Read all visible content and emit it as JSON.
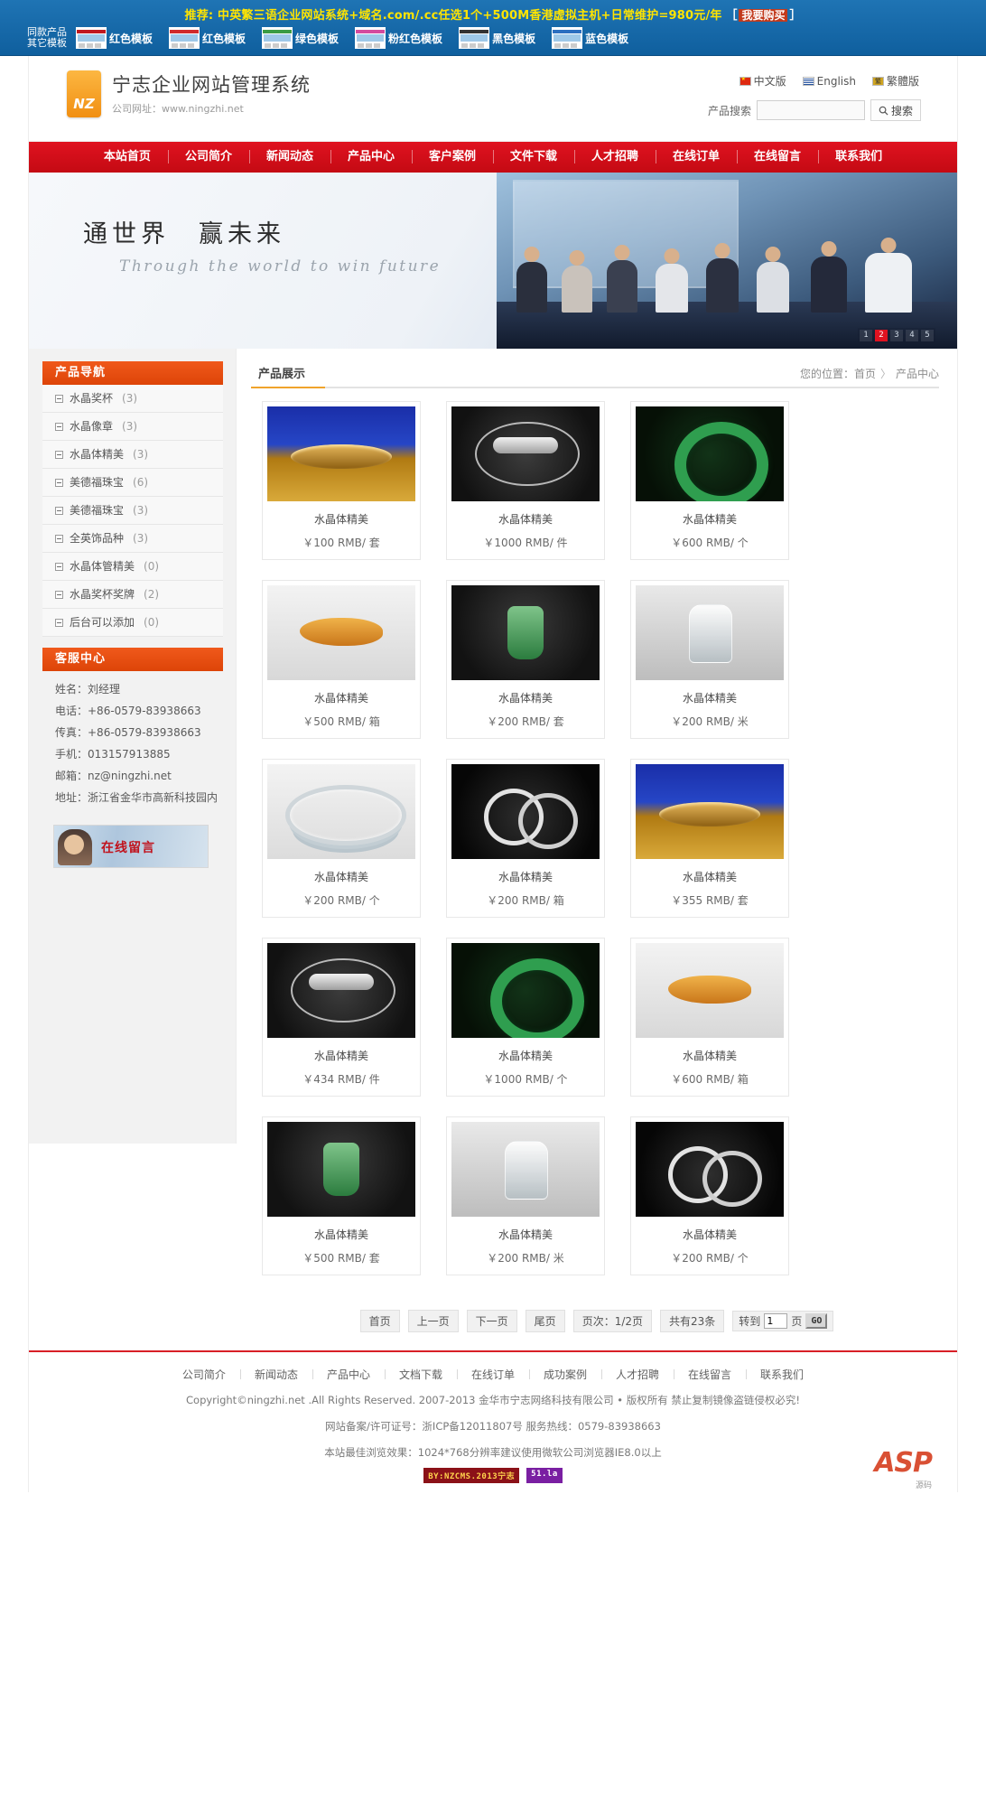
{
  "promo": {
    "recommend_text": "推荐: 中英繁三语企业网站系统+域名.com/.cc任选1个+500M香港虚拟主机+日常维护=980元/年",
    "bracket_open": "［",
    "bracket_close": "］",
    "buy_label": "我要购买",
    "same_product_label_line1": "同款产品",
    "same_product_label_line2": "其它模板",
    "templates": [
      {
        "label": "红色模板",
        "color": "#c01820"
      },
      {
        "label": "红色模板",
        "color": "#d02b2b"
      },
      {
        "label": "绿色模板",
        "color": "#3a9c44"
      },
      {
        "label": "粉红色模板",
        "color": "#d44b9e"
      },
      {
        "label": "黑色模板",
        "color": "#333333"
      },
      {
        "label": "蓝色模板",
        "color": "#2b6fc0"
      }
    ]
  },
  "header": {
    "logo_text": "NZ",
    "site_title": "宁志企业网站管理系统",
    "site_url": "公司网址：www.ningzhi.net",
    "languages": [
      {
        "label": "中文版",
        "flag": "cn"
      },
      {
        "label": "English",
        "flag": "en"
      },
      {
        "label": "繁體版",
        "flag": "tw"
      }
    ],
    "search": {
      "label": "产品搜索",
      "value": "",
      "placeholder": "",
      "button_label": "搜索",
      "button_icon": "search-icon"
    }
  },
  "mainnav": {
    "items": [
      "本站首页",
      "公司简介",
      "新闻动态",
      "产品中心",
      "客户案例",
      "文件下载",
      "人才招聘",
      "在线订单",
      "在线留言",
      "联系我们"
    ]
  },
  "banner": {
    "cn_slogan": "通世界　赢未来",
    "en_slogan": "Through the world to win future",
    "dots": [
      "1",
      "2",
      "3",
      "4",
      "5"
    ],
    "active_dot": "2"
  },
  "sidebar": {
    "products_nav_title": "产品导航",
    "categories": [
      {
        "name": "水晶奖杯",
        "count": "(3)"
      },
      {
        "name": "水晶像章",
        "count": "(3)"
      },
      {
        "name": "水晶体精美",
        "count": "(3)"
      },
      {
        "name": "美德福珠宝",
        "count": "(6)"
      },
      {
        "name": "美德福珠宝",
        "count": "(3)"
      },
      {
        "name": "全英饰品种",
        "count": "(3)"
      },
      {
        "name": "水晶体管精美",
        "count": "(0)"
      },
      {
        "name": "水晶奖杯奖牌",
        "count": "(2)"
      },
      {
        "name": "后台可以添加",
        "count": "(0)"
      }
    ],
    "service_title": "客服中心",
    "contacts": [
      "姓名：刘经理",
      "电话：+86-0579-83938663",
      "传真：+86-0579-83938663",
      "手机：013157913885",
      "邮箱：nz@ningzhi.net",
      "地址：浙江省金华市高新科技园内"
    ],
    "message_banner_label": "在线留言"
  },
  "content": {
    "tab_label": "产品展示",
    "breadcrumb_prefix": "您的位置：",
    "breadcrumb_home": "首页",
    "breadcrumb_sep": "〉",
    "breadcrumb_current": "产品中心",
    "products": [
      {
        "name": "水晶体精美",
        "price": "￥100 RMB/ 套",
        "photo": "ph-gold"
      },
      {
        "name": "水晶体精美",
        "price": "￥1000 RMB/ 件",
        "photo": "ph-keys"
      },
      {
        "name": "水晶体精美",
        "price": "￥600 RMB/ 个",
        "photo": "ph-jadering"
      },
      {
        "name": "水晶体精美",
        "price": "￥500 RMB/ 箱",
        "photo": "ph-amber"
      },
      {
        "name": "水晶体精美",
        "price": "￥200 RMB/ 套",
        "photo": "ph-jadependant"
      },
      {
        "name": "水晶体精美",
        "price": "￥200 RMB/ 米",
        "photo": "ph-buddha"
      },
      {
        "name": "水晶体精美",
        "price": "￥200 RMB/ 个",
        "photo": "ph-bangles"
      },
      {
        "name": "水晶体精美",
        "price": "￥200 RMB/ 箱",
        "photo": "ph-tworings"
      },
      {
        "name": "水晶体精美",
        "price": "￥355 RMB/ 套",
        "photo": "ph-gold"
      },
      {
        "name": "水晶体精美",
        "price": "￥434 RMB/ 件",
        "photo": "ph-keys"
      },
      {
        "name": "水晶体精美",
        "price": "￥1000 RMB/ 个",
        "photo": "ph-jadering"
      },
      {
        "name": "水晶体精美",
        "price": "￥600 RMB/ 箱",
        "photo": "ph-amber"
      },
      {
        "name": "水晶体精美",
        "price": "￥500 RMB/ 套",
        "photo": "ph-jadependant"
      },
      {
        "name": "水晶体精美",
        "price": "￥200 RMB/ 米",
        "photo": "ph-buddha"
      },
      {
        "name": "水晶体精美",
        "price": "￥200 RMB/ 个",
        "photo": "ph-tworings"
      }
    ]
  },
  "pager": {
    "first": "首页",
    "prev": "上一页",
    "next": "下一页",
    "last": "尾页",
    "page_info": "页次：1/2页",
    "total_info": "共有23条",
    "goto_prefix": "转到",
    "goto_value": "1",
    "goto_suffix": "页",
    "go_label": "GO"
  },
  "footer": {
    "links": [
      "公司简介",
      "新闻动态",
      "产品中心",
      "文档下载",
      "在线订单",
      "成功案例",
      "人才招聘",
      "在线留言",
      "联系我们"
    ],
    "copyright": "Copyright©ningzhi.net .All Rights Reserved. 2007-2013 金华市宁志网络科技有限公司 • 版权所有  禁止复制镜像盗链侵权必究!",
    "icp": "网站备案/许可证号：浙ICP备12011807号  服务热线：0579-83938663",
    "browser_tip": "本站最佳浏览效果：1024*768分辨率建议使用微软公司浏览器IE8.0以上",
    "badge_nz": "BY:NZCMS.2013宁志",
    "badge_51": "51.la",
    "asp_logo": "ASP",
    "asp_sub": "源码"
  },
  "colors": {
    "promo_blue": "#1468a8",
    "nav_red": "#d70c18",
    "sidebar_orange": "#e8500f",
    "accent_yellow": "#f0a32b",
    "logo_orange": "#f5a31b"
  }
}
